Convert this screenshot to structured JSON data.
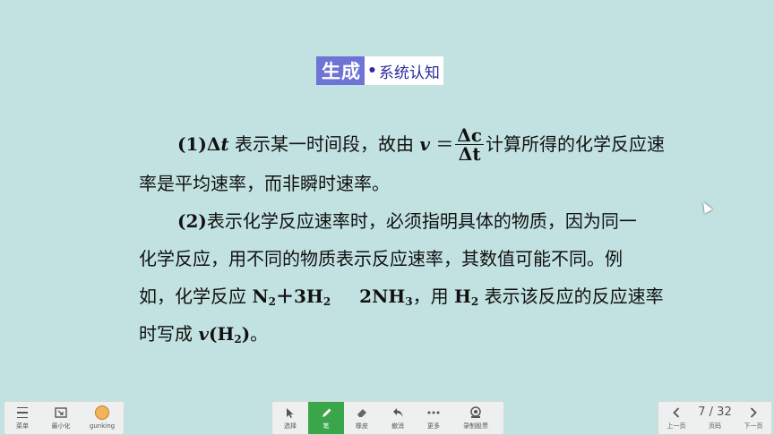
{
  "slide": {
    "title_main": "生成",
    "title_dot": "•",
    "title_sub": "系统认知",
    "p1": {
      "label": "(1)",
      "delta_t": "Δ",
      "t": "t",
      "text_a": " 表示某一时间段，故由 ",
      "v": "v",
      "eq": " ＝",
      "frac_num": "Δc",
      "frac_den": "Δt",
      "text_b": "计算所得的化学反应速",
      "line2": "率是平均速率，而非瞬时速率。"
    },
    "p2": {
      "line1_label": "(2)",
      "line1_text": "表示化学反应速率时，必须指明具体的物质，因为同一",
      "line2": "化学反应，用不同的物质表示反应速率，其数值可能不同。例",
      "line3_a": "如，化学反应 ",
      "n2": "N",
      "n2_sub": "2",
      "plus": "＋3H",
      "h2_sub": "2",
      "nh3": "2NH",
      "nh3_sub": "3",
      "line3_b": "，用 ",
      "h2b": "H",
      "h2b_sub": "2",
      "line3_c": " 表示该反应的反应速率",
      "line4_a": "时写成 ",
      "v": "v",
      "line4_b": "(H",
      "line4_sub": "2",
      "line4_c": ")",
      "line4_end": "。"
    }
  },
  "toolbar": {
    "left": [
      {
        "label": "菜单",
        "icon": "menu-icon"
      },
      {
        "label": "最小化",
        "icon": "minimize-icon"
      },
      {
        "label": "gunking",
        "icon": "avatar-icon"
      }
    ],
    "center": [
      {
        "label": "选择",
        "icon": "cursor-icon"
      },
      {
        "label": "笔",
        "icon": "pen-icon",
        "active": true
      },
      {
        "label": "橡皮",
        "icon": "eraser-icon"
      },
      {
        "label": "撤消",
        "icon": "undo-icon"
      },
      {
        "label": "更多",
        "icon": "more-icon"
      },
      {
        "label": "录制股票",
        "icon": "record-icon"
      }
    ],
    "right": [
      {
        "label": "上一页",
        "icon": "chevron-left-icon"
      },
      {
        "label": "页码",
        "page": "7 / 32"
      },
      {
        "label": "下一页",
        "icon": "chevron-right-icon"
      }
    ],
    "active_color": "#3aa64a"
  }
}
